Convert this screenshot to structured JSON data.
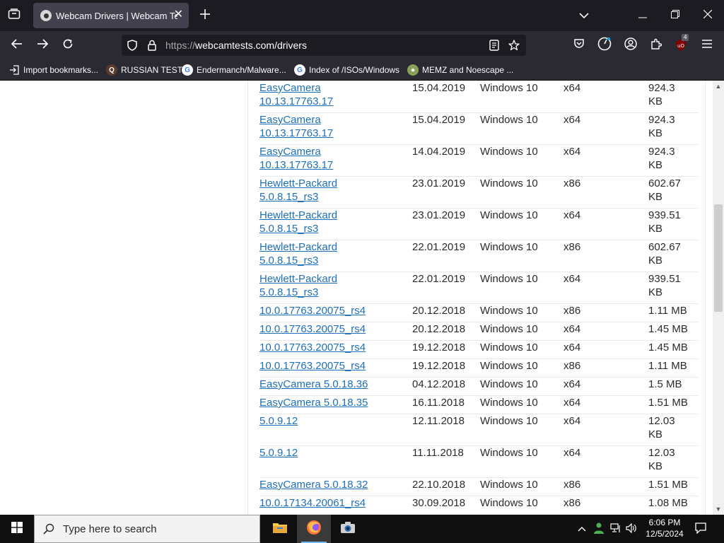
{
  "browser": {
    "tab_title": "Webcam Drivers | Webcam Test",
    "url_prefix": "https://",
    "url_main": "webcamtests.com/drivers",
    "extension_badge": "4",
    "bookmarks": [
      {
        "label": "Import bookmarks...",
        "icon": "import-icon"
      },
      {
        "label": "RUSSIAN TEST",
        "icon": "site-icon"
      },
      {
        "label": "Endermanch/Malware...",
        "icon": "google-icon"
      },
      {
        "label": "Index of /ISOs/Windows",
        "icon": "google-icon"
      },
      {
        "label": "MEMZ and Noescape ...",
        "icon": "site-icon"
      }
    ]
  },
  "drivers": [
    {
      "name": [
        "EasyCamera",
        "10.13.17763.17"
      ],
      "date": "15.04.2019",
      "os": "Windows 10",
      "arch": "x64",
      "size": [
        "924.3",
        "KB"
      ]
    },
    {
      "name": [
        "EasyCamera",
        "10.13.17763.17"
      ],
      "date": "15.04.2019",
      "os": "Windows 10",
      "arch": "x64",
      "size": [
        "924.3",
        "KB"
      ]
    },
    {
      "name": [
        "EasyCamera",
        "10.13.17763.17"
      ],
      "date": "14.04.2019",
      "os": "Windows 10",
      "arch": "x64",
      "size": [
        "924.3",
        "KB"
      ]
    },
    {
      "name": [
        "Hewlett-Packard",
        "5.0.8.15_rs3"
      ],
      "date": "23.01.2019",
      "os": "Windows 10",
      "arch": "x86",
      "size": [
        "602.67",
        "KB"
      ]
    },
    {
      "name": [
        "Hewlett-Packard",
        "5.0.8.15_rs3"
      ],
      "date": "23.01.2019",
      "os": "Windows 10",
      "arch": "x64",
      "size": [
        "939.51",
        "KB"
      ]
    },
    {
      "name": [
        "Hewlett-Packard",
        "5.0.8.15_rs3"
      ],
      "date": "22.01.2019",
      "os": "Windows 10",
      "arch": "x86",
      "size": [
        "602.67",
        "KB"
      ]
    },
    {
      "name": [
        "Hewlett-Packard",
        "5.0.8.15_rs3"
      ],
      "date": "22.01.2019",
      "os": "Windows 10",
      "arch": "x64",
      "size": [
        "939.51",
        "KB"
      ]
    },
    {
      "name": [
        "10.0.17763.20075_rs4"
      ],
      "date": "20.12.2018",
      "os": "Windows 10",
      "arch": "x86",
      "size": [
        "1.11 MB"
      ]
    },
    {
      "name": [
        "10.0.17763.20075_rs4"
      ],
      "date": "20.12.2018",
      "os": "Windows 10",
      "arch": "x64",
      "size": [
        "1.45 MB"
      ]
    },
    {
      "name": [
        "10.0.17763.20075_rs4"
      ],
      "date": "19.12.2018",
      "os": "Windows 10",
      "arch": "x64",
      "size": [
        "1.45 MB"
      ]
    },
    {
      "name": [
        "10.0.17763.20075_rs4"
      ],
      "date": "19.12.2018",
      "os": "Windows 10",
      "arch": "x86",
      "size": [
        "1.11 MB"
      ]
    },
    {
      "name": [
        "EasyCamera 5.0.18.36"
      ],
      "date": "04.12.2018",
      "os": "Windows 10",
      "arch": "x64",
      "size": [
        "1.5 MB"
      ]
    },
    {
      "name": [
        "EasyCamera 5.0.18.35"
      ],
      "date": "16.11.2018",
      "os": "Windows 10",
      "arch": "x64",
      "size": [
        "1.51 MB"
      ]
    },
    {
      "name": [
        "5.0.9.12"
      ],
      "date": "12.11.2018",
      "os": "Windows 10",
      "arch": "x64",
      "size": [
        "12.03",
        "KB"
      ]
    },
    {
      "name": [
        "5.0.9.12"
      ],
      "date": "11.11.2018",
      "os": "Windows 10",
      "arch": "x64",
      "size": [
        "12.03",
        "KB"
      ]
    },
    {
      "name": [
        "EasyCamera 5.0.18.32"
      ],
      "date": "22.10.2018",
      "os": "Windows 10",
      "arch": "x86",
      "size": [
        "1.51 MB"
      ]
    },
    {
      "name": [
        "10.0.17134.20061_rs4"
      ],
      "date": "30.09.2018",
      "os": "Windows 10",
      "arch": "x86",
      "size": [
        "1.08 MB"
      ]
    }
  ],
  "taskbar": {
    "search_placeholder": "Type here to search",
    "time": "6:06 PM",
    "date": "12/5/2024"
  },
  "colors": {
    "link": "#1f6fb8",
    "browser_bg": "#1c1b22",
    "toolbar_bg": "#2b2a33",
    "taskbar_bg": "#101010"
  }
}
